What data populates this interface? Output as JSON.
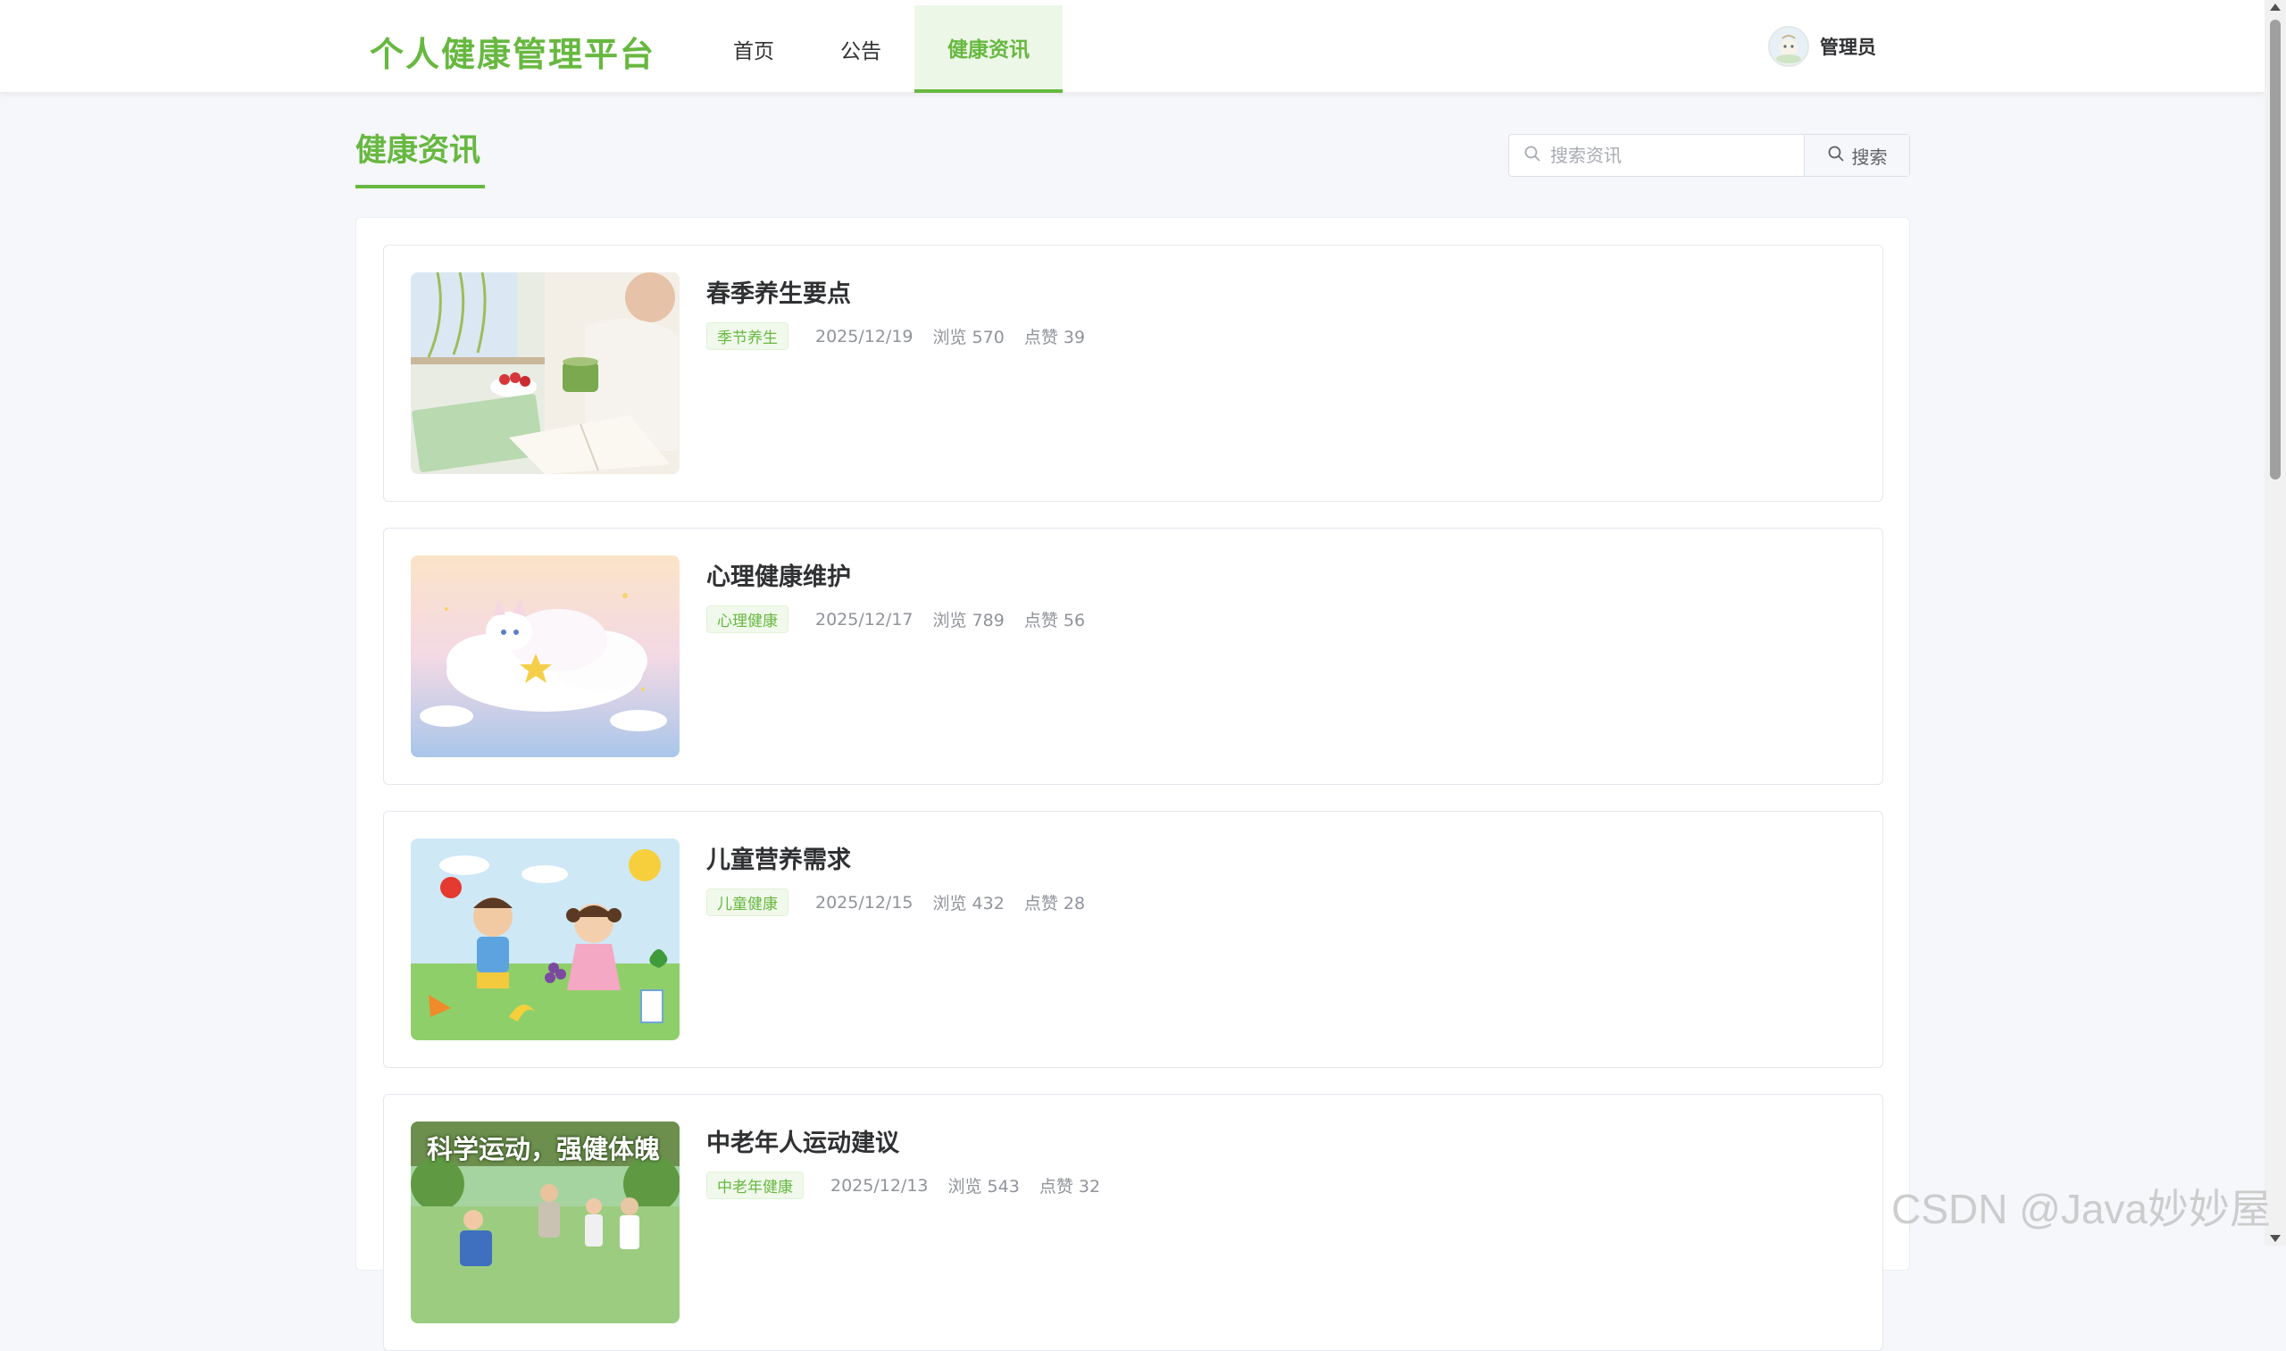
{
  "header": {
    "logo": "个人健康管理平台",
    "nav": [
      {
        "label": "首页",
        "active": false
      },
      {
        "label": "公告",
        "active": false
      },
      {
        "label": "健康资讯",
        "active": true
      }
    ],
    "user": {
      "name": "管理员"
    }
  },
  "page": {
    "title": "健康资讯",
    "search": {
      "placeholder": "搜索资讯",
      "value": "",
      "button_label": "搜索"
    }
  },
  "articles": [
    {
      "title": "春季养生要点",
      "tag": "季节养生",
      "date": "2025/12/19",
      "views": "浏览 570",
      "likes": "点赞 39",
      "image": "spring-wellness-illustration"
    },
    {
      "title": "心理健康维护",
      "tag": "心理健康",
      "date": "2025/12/17",
      "views": "浏览 789",
      "likes": "点赞 56",
      "image": "sleeping-cat-cloud-illustration"
    },
    {
      "title": "儿童营养需求",
      "tag": "儿童健康",
      "date": "2025/12/15",
      "views": "浏览 432",
      "likes": "点赞 28",
      "image": "children-fruits-illustration"
    },
    {
      "title": "中老年人运动建议",
      "tag": "中老年健康",
      "date": "2025/12/13",
      "views": "浏览 543",
      "likes": "点赞 32",
      "image": "seniors-exercise-illustration",
      "image_caption": "科学运动，强健体魄"
    }
  ],
  "watermark": "CSDN @Java妙妙屋",
  "colors": {
    "accent": "#67b840",
    "tag_bg": "#f0f9eb",
    "text": "#303133",
    "muted": "#909399"
  }
}
